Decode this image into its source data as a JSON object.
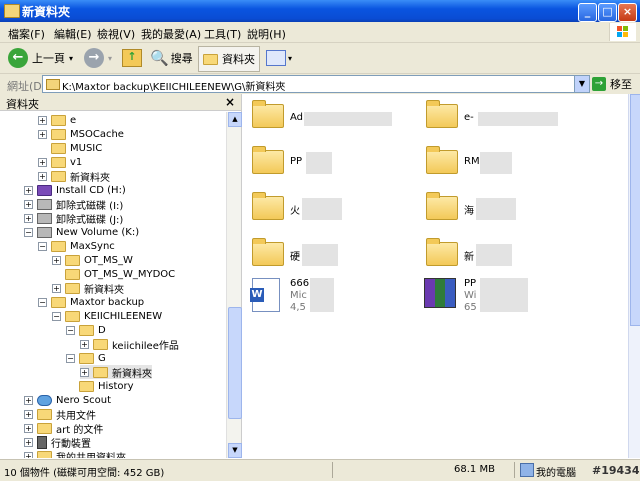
{
  "window": {
    "title": "新資料夾",
    "icon": "folder-icon"
  },
  "menu": [
    "檔案(F)",
    "編輯(E)",
    "檢視(V)",
    "我的最愛(A)",
    "工具(T)",
    "說明(H)"
  ],
  "toolbar": {
    "back": "上一頁",
    "search": "搜尋",
    "folders": "資料夾"
  },
  "address": {
    "label": "網址(D)",
    "value": "K:\\Maxtor backup\\KEIICHILEENEW\\G\\新資料夾",
    "go": "移至"
  },
  "pane": {
    "title": "資料夾"
  },
  "tree": [
    {
      "label": "e"
    },
    {
      "label": "MSOCache"
    },
    {
      "label": "MUSIC"
    },
    {
      "label": "v1"
    },
    {
      "label": "新資料夾"
    },
    {
      "label": "Install CD (H:)"
    },
    {
      "label": "卸除式磁碟 (I:)"
    },
    {
      "label": "卸除式磁碟 (J:)"
    },
    {
      "label": "New Volume (K:)"
    },
    {
      "label": "MaxSync"
    },
    {
      "label": "OT_MS_W"
    },
    {
      "label": "OT_MS_W_MYDOC"
    },
    {
      "label": "新資料夾"
    },
    {
      "label": "Maxtor backup"
    },
    {
      "label": "KEIICHILEENEW"
    },
    {
      "label": "D"
    },
    {
      "label": "keiichilee作品"
    },
    {
      "label": "G"
    },
    {
      "label": "新資料夾"
    },
    {
      "label": "History"
    },
    {
      "label": "Nero Scout"
    },
    {
      "label": "共用文件"
    },
    {
      "label": "art 的文件"
    },
    {
      "label": "行動裝置"
    },
    {
      "label": "我的共用資料夾"
    }
  ],
  "files": [
    {
      "name": "Ad",
      "type": "folder"
    },
    {
      "name": "e-",
      "type": "folder"
    },
    {
      "name": "PP",
      "type": "folder"
    },
    {
      "name": "RM",
      "type": "folder"
    },
    {
      "name": "火",
      "type": "folder"
    },
    {
      "name": "海",
      "type": "folder"
    },
    {
      "name": "硬",
      "type": "folder"
    },
    {
      "name": "新",
      "type": "folder"
    },
    {
      "name": "666",
      "line2": "Mic",
      "line3": "4,5",
      "type": "word"
    },
    {
      "name": "PP",
      "line2": "Wi",
      "line3": "65",
      "type": "rar"
    }
  ],
  "status": {
    "objects": "10 個物件 (磁碟可用空間: 452 GB)",
    "size": "68.1 MB",
    "computer": "我的電腦"
  },
  "watermark": "#19434"
}
